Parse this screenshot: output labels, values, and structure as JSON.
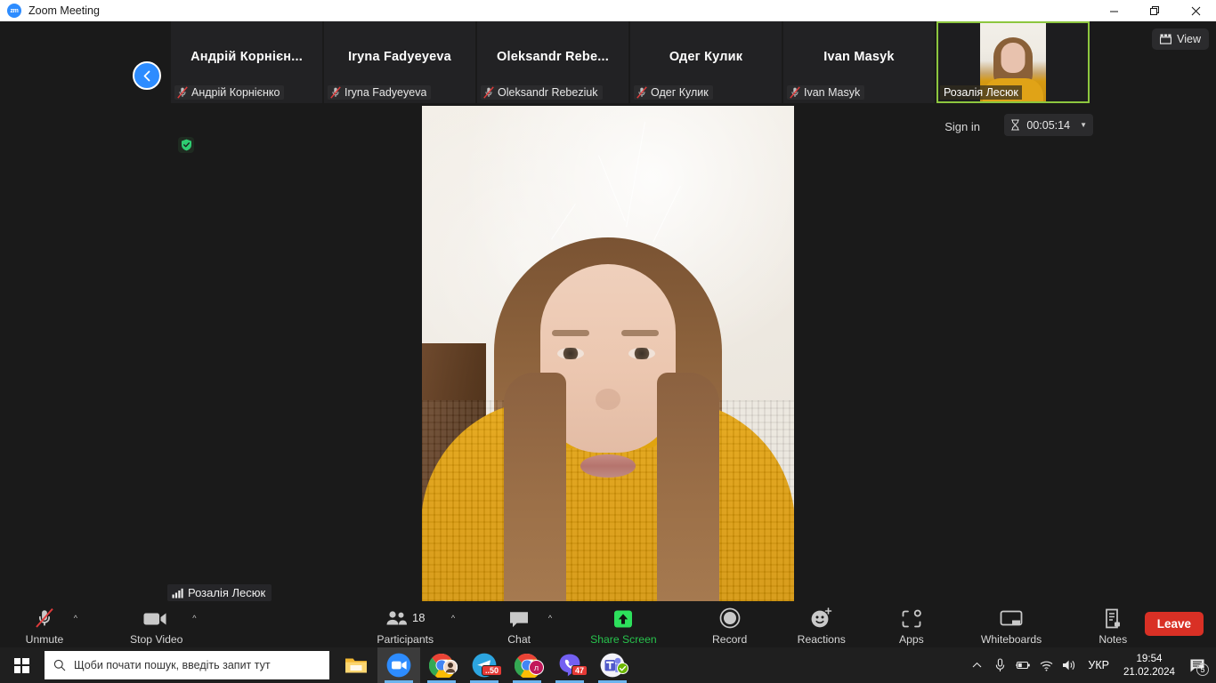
{
  "window": {
    "title": "Zoom Meeting",
    "logo_text": "zm",
    "minimize_label": "—",
    "restore_label": "❐",
    "close_label": "✕"
  },
  "filmstrip": {
    "back_button_name": "back-to-gallery",
    "participants": [
      {
        "display_name": "Андрій Корнієн...",
        "label_name": "Андрій Корнієнко",
        "muted": true,
        "self": false
      },
      {
        "display_name": "Iryna Fadyeyeva",
        "label_name": "Iryna Fadyeyeva",
        "muted": true,
        "self": false
      },
      {
        "display_name": "Oleksandr  Rebe...",
        "label_name": "Oleksandr Rebeziuk",
        "muted": true,
        "self": false
      },
      {
        "display_name": "Одег Кулик",
        "label_name": "Одег Кулик",
        "muted": true,
        "self": false
      },
      {
        "display_name": "Ivan Masyk",
        "label_name": "Ivan Masyk",
        "muted": true,
        "self": false
      },
      {
        "display_name": "",
        "label_name": "Розалія Лесюк",
        "muted": false,
        "self": true
      }
    ]
  },
  "top_controls": {
    "view_label": "View",
    "view_icon": "grid-icon",
    "sign_in_label": "Sign in",
    "timer_value": "00:05:14",
    "timer_icon": "hourglass-icon",
    "timer_caret": "▼",
    "encryption_icon": "shield-check-icon"
  },
  "main_stage": {
    "active_speaker_name": "Розалія Лесюк",
    "speaker_icon": "audio-bars-icon"
  },
  "toolbar": {
    "items": [
      {
        "name": "unmute",
        "label": "Unmute",
        "icon": "microphone-muted-icon",
        "has_chevron": true,
        "green": false
      },
      {
        "name": "stop-video",
        "label": "Stop Video",
        "icon": "camera-icon",
        "has_chevron": true,
        "green": false
      },
      {
        "name": "participants",
        "label": "Participants",
        "icon": "people-icon",
        "count": "18",
        "has_chevron": true,
        "green": false
      },
      {
        "name": "chat",
        "label": "Chat",
        "icon": "chat-bubble-icon",
        "has_chevron": true,
        "green": false
      },
      {
        "name": "share-screen",
        "label": "Share Screen",
        "icon": "share-up-arrow-icon",
        "has_chevron": false,
        "green": true
      },
      {
        "name": "record",
        "label": "Record",
        "icon": "record-circle-icon",
        "has_chevron": false,
        "green": false
      },
      {
        "name": "reactions",
        "label": "Reactions",
        "icon": "smiley-plus-icon",
        "has_chevron": false,
        "green": false
      },
      {
        "name": "apps",
        "label": "Apps",
        "icon": "apps-icon",
        "has_chevron": false,
        "green": false
      },
      {
        "name": "whiteboards",
        "label": "Whiteboards",
        "icon": "whiteboard-icon",
        "has_chevron": false,
        "green": false
      },
      {
        "name": "notes",
        "label": "Notes",
        "icon": "notes-icon",
        "has_chevron": false,
        "green": false
      }
    ],
    "leave_label": "Leave"
  },
  "taskbar": {
    "start_icon": "windows-logo-icon",
    "search_placeholder": "Щоби почати пошук, введіть запит тут",
    "search_icon": "search-icon",
    "apps": [
      {
        "name": "file-explorer",
        "icon": "folder-icon",
        "badge": "",
        "active": false,
        "running": false
      },
      {
        "name": "zoom",
        "icon": "zoom-icon",
        "badge": "",
        "active": true,
        "running": true
      },
      {
        "name": "chrome-profile",
        "icon": "chrome-icon",
        "badge": "",
        "active": false,
        "running": true
      },
      {
        "name": "telegram",
        "icon": "telegram-icon",
        "badge": "..50",
        "active": false,
        "running": true
      },
      {
        "name": "chrome-second",
        "icon": "chrome-icon",
        "badge": "",
        "active": false,
        "running": true
      },
      {
        "name": "viber",
        "icon": "viber-icon",
        "badge": "47",
        "active": false,
        "running": true
      },
      {
        "name": "microsoft-teams",
        "icon": "teams-icon",
        "badge": "",
        "active": false,
        "running": true
      }
    ],
    "tray": {
      "overflow_icon": "chevron-up-icon",
      "microphone_icon": "microphone-icon",
      "battery_icon": "battery-icon",
      "wifi_icon": "wifi-icon",
      "volume_icon": "speaker-icon",
      "language": "УКР",
      "time": "19:54",
      "date": "21.02.2024",
      "notification_icon": "notification-icon",
      "notification_count": "5"
    }
  },
  "colors": {
    "accent_blue": "#2d8cff",
    "active_green": "#8dc63f",
    "share_green": "#27c24c",
    "leave_red": "#d93025",
    "app_bg": "#1a1a1a"
  }
}
